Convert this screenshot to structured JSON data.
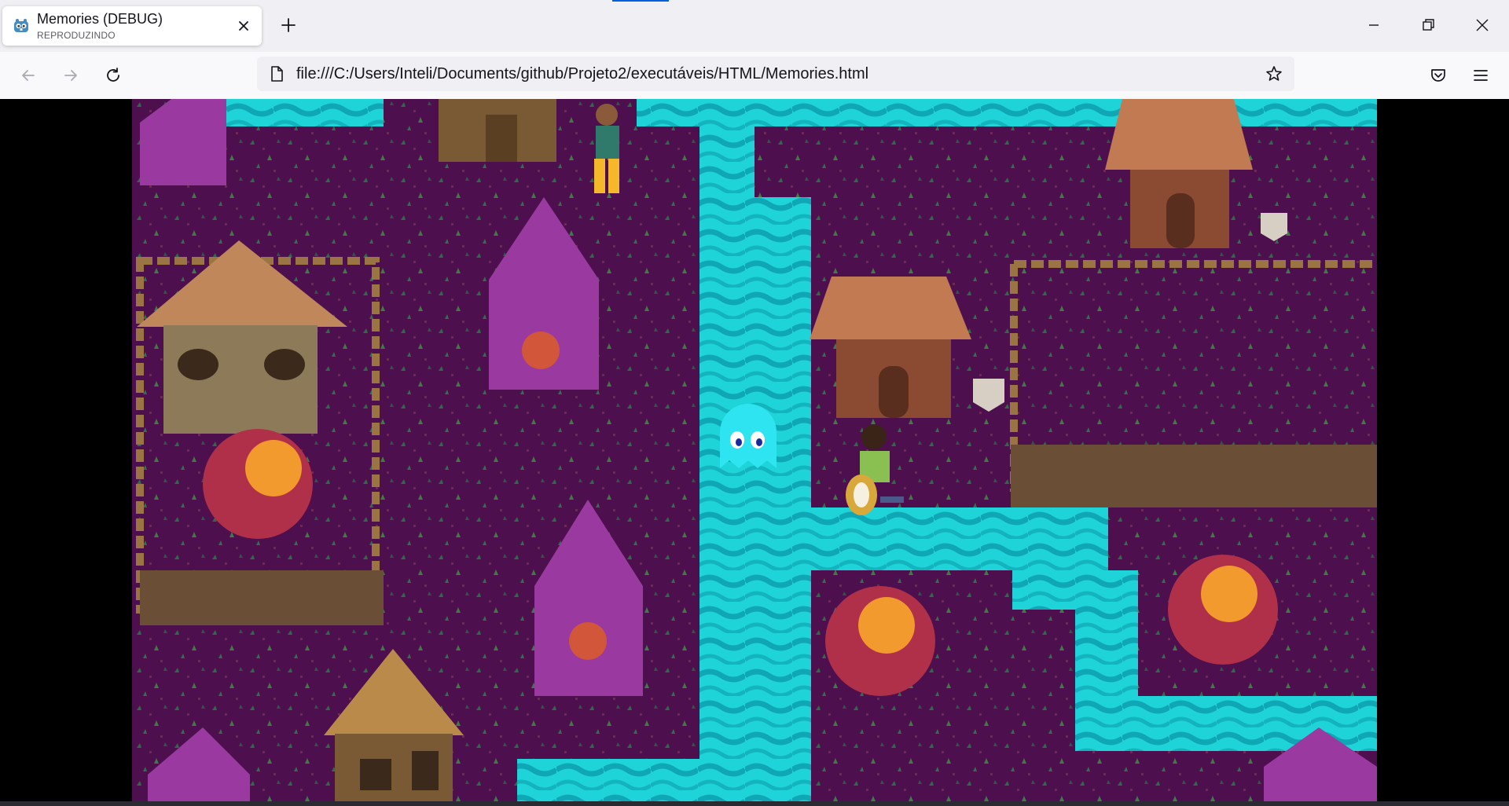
{
  "browser": {
    "tab": {
      "title": "Memories (DEBUG)",
      "subtitle": "REPRODUZINDO",
      "icon": "godot-icon"
    },
    "url": "file:///C:/Users/Inteli/Documents/github/Projeto2/executáveis/HTML/Memories.html",
    "accent_color": "#0060df"
  },
  "game": {
    "colors": {
      "ground": "#4d0f4d",
      "water": "#1fd4d8",
      "water_dark": "#0a8fa0",
      "ghost": "#2ee4f0"
    }
  }
}
